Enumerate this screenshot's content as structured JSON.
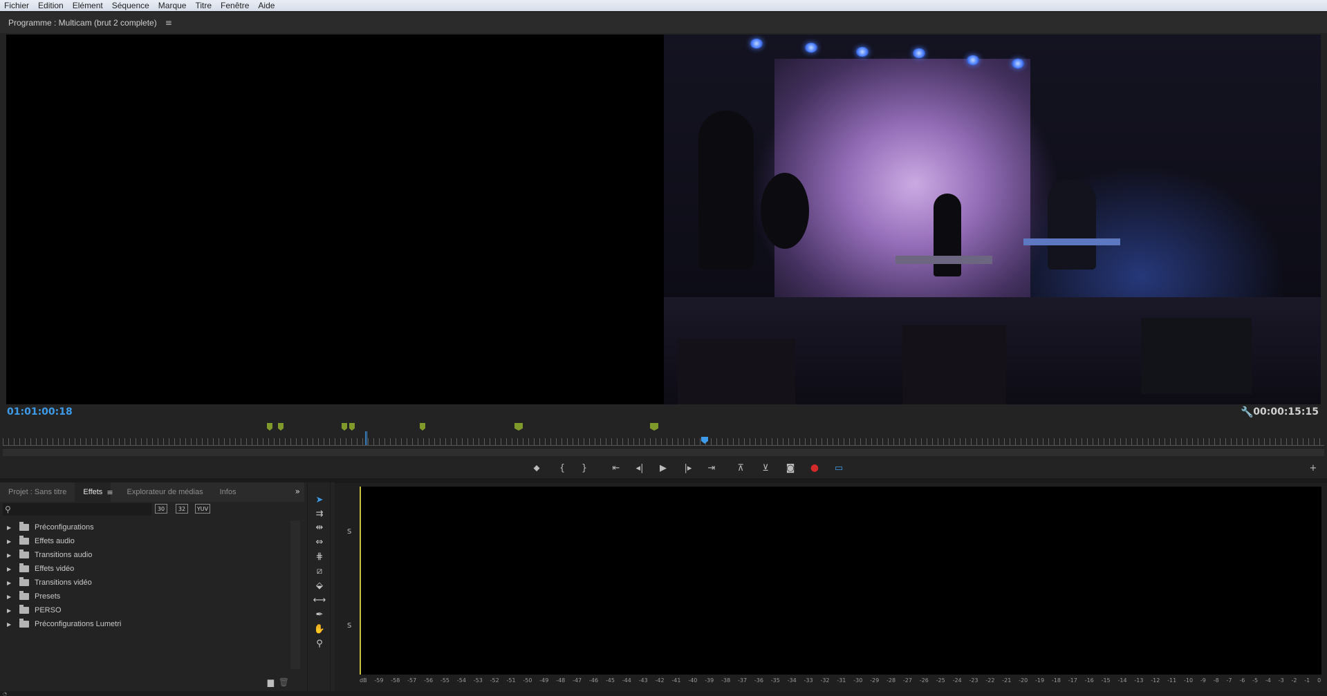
{
  "menu": [
    "Fichier",
    "Edition",
    "Elément",
    "Séquence",
    "Marque",
    "Titre",
    "Fenêtre",
    "Aide"
  ],
  "program": {
    "title": "Programme : Multicam (brut 2 complete)",
    "menu_icon": "≡",
    "timecode_left": "01:01:00:18",
    "timecode_right": "00:00:15:15"
  },
  "transport_icons": [
    "marker-icon",
    "mark-in-icon",
    "mark-out-icon",
    "go-to-in-icon",
    "step-back-icon",
    "play-icon",
    "step-forward-icon",
    "go-to-out-icon",
    "lift-icon",
    "extract-icon",
    "export-frame-icon",
    "record-icon",
    "multicam-icon",
    "add-button-icon"
  ],
  "effects_panel": {
    "tabs": [
      "Projet : Sans titre",
      "Effets",
      "Explorateur de médias",
      "Infos"
    ],
    "active_tab": "Effets",
    "tab_menu_icon": "≡",
    "more_icon": "»",
    "search": {
      "value": "",
      "placeholder": ""
    },
    "filter_buttons": [
      "30",
      "32",
      "YUV"
    ],
    "tree": [
      "Préconfigurations",
      "Effets audio",
      "Transitions audio",
      "Effets vidéo",
      "Transitions vidéo",
      "Presets",
      "PERSO",
      "Préconfigurations Lumetri"
    ]
  },
  "tools": [
    "selection-tool-icon",
    "track-select-tool-icon",
    "ripple-edit-tool-icon",
    "rolling-edit-tool-icon",
    "rate-stretch-tool-icon",
    "razor-tool-icon",
    "slip-tool-icon",
    "slide-tool-icon",
    "pen-tool-icon",
    "hand-tool-icon",
    "zoom-tool-icon"
  ],
  "audio_meter": {
    "channel_labels": [
      "S",
      "S"
    ],
    "db_scale": [
      "dB",
      "-59",
      "-58",
      "-57",
      "-56",
      "-55",
      "-54",
      "-53",
      "-52",
      "-51",
      "-50",
      "-49",
      "-48",
      "-47",
      "-46",
      "-45",
      "-44",
      "-43",
      "-42",
      "-41",
      "-40",
      "-39",
      "-38",
      "-37",
      "-36",
      "-35",
      "-34",
      "-33",
      "-32",
      "-31",
      "-30",
      "-29",
      "-28",
      "-27",
      "-26",
      "-25",
      "-24",
      "-23",
      "-22",
      "-21",
      "-20",
      "-19",
      "-18",
      "-17",
      "-16",
      "-15",
      "-14",
      "-13",
      "-12",
      "-11",
      "-10",
      "-9",
      "-8",
      "-7",
      "-6",
      "-5",
      "-4",
      "-3",
      "-2",
      "-1",
      "0"
    ]
  },
  "colors": {
    "accent": "#3d9be9",
    "marker": "#7f9a2b",
    "record": "#d42a2a",
    "meter_line": "#c8c040"
  }
}
